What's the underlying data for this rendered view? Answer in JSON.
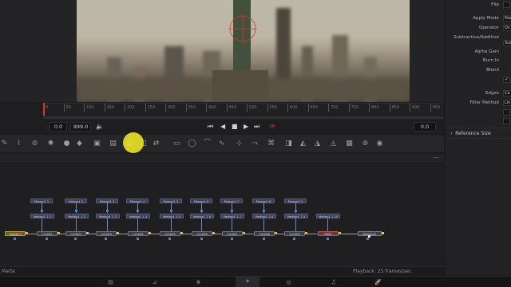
{
  "viewer": {
    "timecode_start": "0.0",
    "timecode_end": "999.0",
    "current_frame": "0.0"
  },
  "ruler": {
    "ticks": [
      "0",
      "50",
      "100",
      "150",
      "200",
      "250",
      "300",
      "350",
      "400",
      "450",
      "500",
      "550",
      "600",
      "650",
      "700",
      "750",
      "800",
      "850",
      "900",
      "950"
    ]
  },
  "inspector": {
    "flip_label": "Flip",
    "apply_mode_label": "Apply Mode",
    "apply_mode_value": "Nor",
    "operator_label": "Operator",
    "operator_value": "Ov",
    "subtractive_label": "Subtractive/Additive",
    "subtractive_value": "Subtra",
    "alpha_gain_label": "Alpha Gain",
    "burn_in_label": "Burn In",
    "blend_label": "Blend",
    "blend_value": "",
    "edges_label": "Edges",
    "edges_value": "Ca",
    "filter_method_label": "Filter Method",
    "filter_method_value": "Lin",
    "checkmark": "✓",
    "reference_size_label": "Reference Size"
  },
  "node_graph": {
    "polygon_nodes": [
      "Polygon1_1",
      "Polygon1_2",
      "Polygon1_3",
      "Polygon1_4",
      "Polygon1_5",
      "Polygon1_6",
      "Polygon1_7",
      "Polygon1_8",
      "Polygon1_9"
    ],
    "mask_nodes": [
      "Mediain1_1_1",
      "Mediain1_1_2",
      "Mediain1_1_3",
      "Mediain1_1_4",
      "Mediain1_1_5",
      "Mediain1_1_6",
      "Mediain1_1_7",
      "Mediain1_1_8",
      "Mediain1_1_9",
      "Mediain1_1_10"
    ],
    "merge_nodes": [
      "MediaIn1",
      "CLOUD1",
      "CLOUD2",
      "CLOUD3",
      "CLOUD4",
      "CLOUD5",
      "CLOUD6",
      "CLOUD7",
      "CLOUD8",
      "CLOUD9",
      "MASK",
      "MediaOut1"
    ]
  },
  "status": {
    "left": "Matte",
    "right": "Playback: 25 frames/sec"
  },
  "pages": [
    "Media",
    "Cut",
    "Edit",
    "Fusion",
    "Color",
    "Fairlight",
    "Deliver"
  ],
  "toolbar_icons": [
    "brush-icon",
    "text-icon",
    "shape-icon",
    "particle-icon",
    "paint-icon",
    "drop-icon",
    "background-icon",
    "image-icon",
    "merge-icon",
    "mask-icon",
    "transform-icon",
    "rect-mask-icon",
    "ellipse-mask-icon",
    "polygon-mask-icon",
    "bspline-icon",
    "tracker-icon",
    "warp-icon",
    "lens-icon",
    "3d-icon",
    "shape3d-icon",
    "camera-icon",
    "light-icon",
    "render-icon",
    "text3d-icon",
    "merge3d-icon"
  ],
  "colors": {
    "accent": "#e6362c",
    "cursor_highlight": "#e6de28",
    "wire": "#b8a24a"
  }
}
